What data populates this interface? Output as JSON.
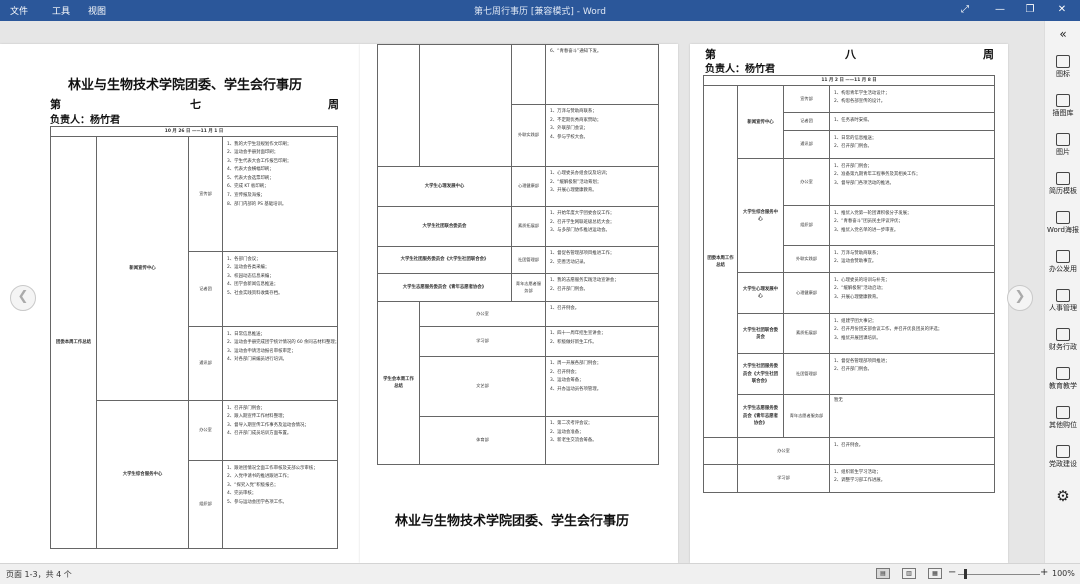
{
  "titlebar": {
    "menu": [
      "文件",
      "工具",
      "视图"
    ],
    "title": "第七周行事历 [兼容模式] - Word"
  },
  "doc": {
    "title": "林业与生物技术学院团委、学生会行事历",
    "p1": {
      "week_left": "第",
      "week_mid": "七",
      "week_right": "周",
      "owner": "负责人：杨竹君",
      "date": "10 月 26 日 ——11 月 1 日",
      "col_a": "团委本周工作总结",
      "unit1": "新闻宣传中心",
      "unit2": "大学生综合服务中心",
      "dept1": "宣传部",
      "dept2": "记者团",
      "dept3": "通讯部",
      "dept4": "办公室",
      "dept5": "组织部",
      "list1": [
        "1、我的大学生涯规划作文印刷；",
        "2、运动会手册封面印刷；",
        "3、学生代表大会工作报告印刷；",
        "4、代表大会横幅印刷；",
        "5、代表大会选票印刷；",
        "6、完成 KT 板印刷；",
        "7、宣传报及海报；",
        "8、部门内部的 PS 基础培训。"
      ],
      "list2": [
        "1、各部门会议；",
        "2、运动会各类采编；",
        "3、校园动态信息采编；",
        "4、团学会新闻信息推送；",
        "5、社会实践资料收集存档。"
      ],
      "list3": [
        "1、日常信息推送；",
        "2、运动会手册完成团学统计情况的 60 余同志材料整理；",
        "3、运动会申请活动报名审核审定；",
        "4、对各部门采编员进行培训。"
      ],
      "list4": [
        "1、召开部门例会；",
        "2、跟入期宣传工作材料整理；",
        "3、督导入期宣传工作事务及运动会情况；",
        "4、召开部门成员培训方面布置。"
      ],
      "list5": [
        "1、跟进团情况全面工作审核及支部公示审核；",
        "2、入党申请书的推进跟进工作；",
        "3、“探究入党”积极报名；",
        "4、完员审核；",
        "5、参与运动会团学各项工作。"
      ]
    },
    "p2": {
      "top_item": "6、“青春奋斗”通知下发。",
      "dept_ext": "外联实践部",
      "list_ext": [
        "1、万泽与赞助商联系；",
        "2、不定期优秀商家赞助；",
        "3、外联部门会议；",
        "4、参与学校大会。"
      ],
      "unit_psy": "大学生心理发展中心",
      "dept_psy": "心理健康部",
      "list_psy": [
        "1、心理委员办组会议及培训；",
        "2、“缓解极限”活动筹划；",
        "3、开展心理健康教育。"
      ],
      "unit_org": "大学生社团联合委员会",
      "dept_org": "素质拓展部",
      "list_org": [
        "1、开始年度大学团委会议工作；",
        "2、召开学生网联班级总结大会；",
        "3、与多部门协作推进运动会。"
      ],
      "unit_com": "大学生社团服务委员会《大学生社团联合会》",
      "dept_com": "社团管理部",
      "list_com": [
        "1、督促各管理部项目推进工作；",
        "2、完善活动记录。"
      ],
      "unit_vol": "大学生志愿服务委员会《青年志愿者协会》",
      "dept_vol": "青年志愿者服务部",
      "list_vol": [
        "1、我的志愿服务实践活动宣讲会；",
        "2、召开部门例会。"
      ],
      "col_b": "学生会本周工作总结",
      "d_off": "办公室",
      "d_stu": "学习部",
      "d_lit": "文艺部",
      "d_sport": "体育部",
      "l_off": [
        "1、召开例会。"
      ],
      "l_stu": [
        "1、四十一周年招生宣讲会；",
        "2、积极做好新生工作。"
      ],
      "l_lit": [
        "1、周一开展各部门例会；",
        "2、召开例会；",
        "3、运动会筹备；",
        "4、开办运动员各项管理。"
      ],
      "l_sport": [
        "1、第二次考评会议；",
        "2、运动会准备；",
        "3、新老生交流会筹备。"
      ],
      "footer_title": "林业与生物技术学院团委、学生会行事历"
    },
    "p3": {
      "week_left": "第",
      "week_mid": "八",
      "week_right": "周",
      "owner": "负责人：杨竹君",
      "date": "11 月 2 日 ——11 月 8 日",
      "col_a": "团委本周工作总结",
      "unit_news": "新闻宣传中心",
      "d_pub": "宣传部",
      "d_rep": "记者团",
      "d_com": "通讯部",
      "l_pub": [
        "1、构思青年学生活动设计；",
        "2、构思各部宣传的设计。"
      ],
      "l_rep": [
        "1、任务表时安排。"
      ],
      "l_com": [
        "1、日常的信息推送；",
        "2、召开部门例会。"
      ],
      "unit_serv": "大学生综合服务中心",
      "d_off": "办公室",
      "d_org": "组织部",
      "d_ext": "外联实践部",
      "l_off": [
        "1、召开部门例会；",
        "2、准备第九期青年工程事务及其相关工作；",
        "3、督导部门各项活动的推进。"
      ],
      "l_org": [
        "1、推优入党第一轮团课积极分子发展；",
        "2、“青春奋斗”团员民主评议评优；",
        "3、推优入党名单的进一步审查。"
      ],
      "l_ext": [
        "1、万泽与赞助商联系；",
        "2、运动会赞助事宜。"
      ],
      "unit_psy": "大学生心理发展中心",
      "d_psy": "心理健康部",
      "l_psy": [
        "1、心理委员的培训与补充；",
        "2、“缓解极限”活动启动；",
        "3、开展心理健康教育。"
      ],
      "unit_org2": "大学生社团联合委员会",
      "d_qual": "素质拓展部",
      "l_qual": [
        "1、组建学团大事记；",
        "2、召开月份团支部会议工作，并召开优良团员的评选；",
        "3、推优开展团课培训。"
      ],
      "unit_com": "大学生社团服务委员会《大学生社团联合会》",
      "d_cm": "社团管理部",
      "l_cm": [
        "1、督促各管理部项目推进；",
        "2、召开部门例会。"
      ],
      "unit_vol": "大学生志愿服务委员会《青年志愿者协会》",
      "d_vol": "青年志愿者服务部",
      "l_vol": "暂无",
      "d_off2": "办公室",
      "l_off2": [
        "1、召开例会。"
      ],
      "d_stu": "学习部",
      "l_stu": [
        "1、组织新生学习活动；",
        "2、调整学习部工作进展。"
      ]
    }
  },
  "rightpane": [
    "图标",
    "插图库",
    "图片",
    "简历模板",
    "Word海报",
    "办公发用",
    "人事管理",
    "财务行政",
    "教育教学",
    "其他购位",
    "党政建设"
  ],
  "statusbar": {
    "page": "页面 1-3，共 4 个",
    "zoom": "100%"
  }
}
